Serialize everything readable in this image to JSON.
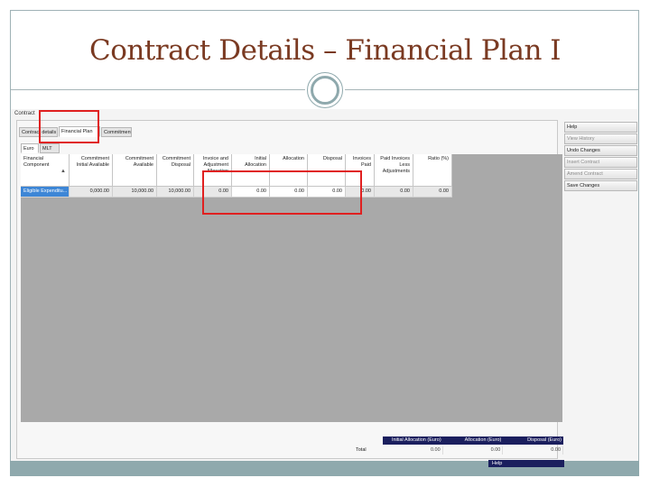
{
  "slide": {
    "title": "Contract Details – Financial Plan I"
  },
  "app": {
    "window_label": "Contract",
    "tabs": [
      "Contract details",
      "Financial Plan",
      "Commitment"
    ],
    "currency_tabs": [
      "Euro",
      "MLT"
    ]
  },
  "grid": {
    "columns": [
      "Financial Component",
      "Commitment Initial Available",
      "Commitment Available",
      "Commitment Disposal",
      "Invoice and Adjustment Allocation",
      "Initial Allocation",
      "Allocation",
      "Disposal",
      "Invoices Paid",
      "Paid Invoices Less Adjustments",
      "Ratio (%)"
    ],
    "rows": [
      [
        "Eligible Expenditu...",
        "0,000.00",
        "10,000.00",
        "10,000.00",
        "0.00",
        "0.00",
        "0.00",
        "0.00",
        "0.00",
        "0.00",
        "0.00"
      ]
    ]
  },
  "side_buttons": [
    "Help",
    "View History",
    "Undo Changes",
    "Insert Contract",
    "Amend Contract",
    "Save Changes"
  ],
  "totals": {
    "headers": [
      "Initial Allocation (Euro)",
      "Allocation (Euro)",
      "Disposal (Euro)"
    ],
    "label": "Total",
    "values": [
      "0.00",
      "0.00",
      "0.00"
    ]
  },
  "footer": {
    "help_label": "Help"
  }
}
